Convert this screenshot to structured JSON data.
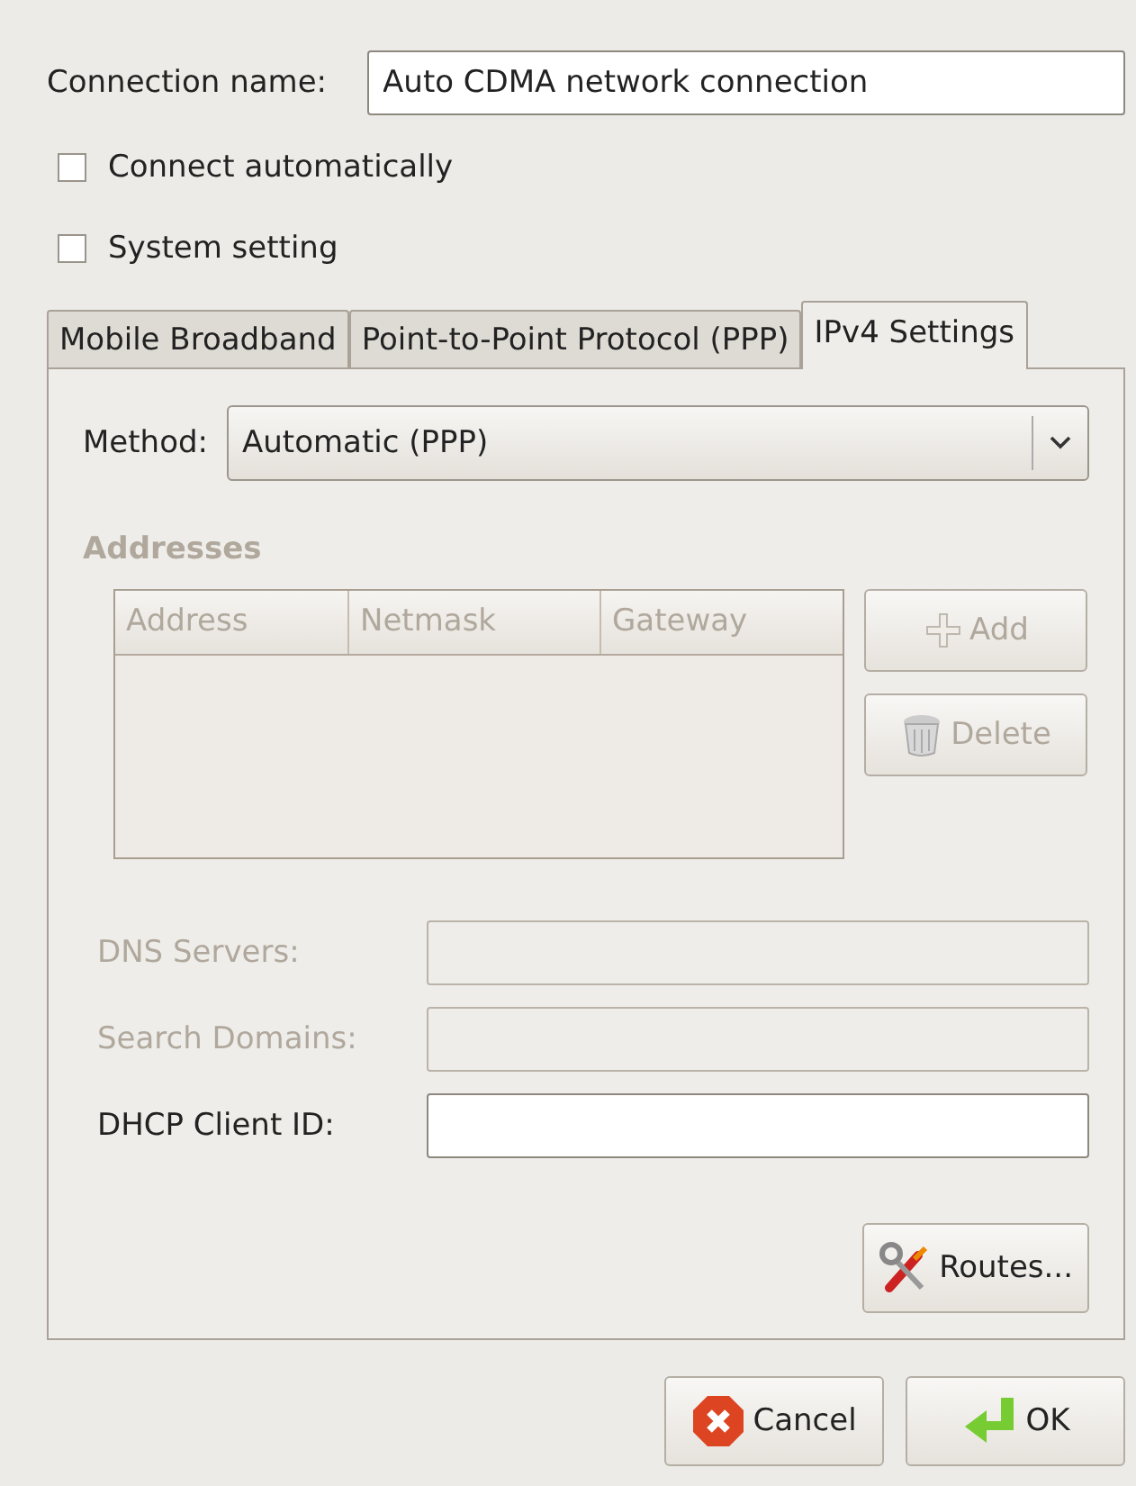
{
  "connection_name": {
    "label": "Connection name:",
    "value": "Auto CDMA network connection"
  },
  "options": [
    {
      "label": "Connect automatically",
      "checked": false
    },
    {
      "label": "System setting",
      "checked": false
    }
  ],
  "tabs": [
    {
      "label": "Mobile Broadband",
      "selected": false
    },
    {
      "label": "Point-to-Point Protocol (PPP)",
      "selected": false
    },
    {
      "label": "IPv4 Settings",
      "selected": true
    }
  ],
  "method": {
    "label": "Method:",
    "value": "Automatic (PPP)"
  },
  "addresses": {
    "title": "Addresses",
    "disabled": true,
    "columns": [
      "Address",
      "Netmask",
      "Gateway"
    ],
    "buttons": [
      {
        "kind": "add",
        "label": "Add"
      },
      {
        "kind": "delete",
        "label": "Delete"
      }
    ]
  },
  "fields": [
    {
      "label": "DNS Servers:",
      "disabled": true
    },
    {
      "label": "Search Domains:",
      "disabled": true
    },
    {
      "label": "DHCP Client ID:",
      "disabled": false
    }
  ],
  "routes_button": "Routes...",
  "buttons": [
    {
      "kind": "cancel",
      "label": "Cancel"
    },
    {
      "kind": "ok",
      "label": "OK"
    }
  ]
}
